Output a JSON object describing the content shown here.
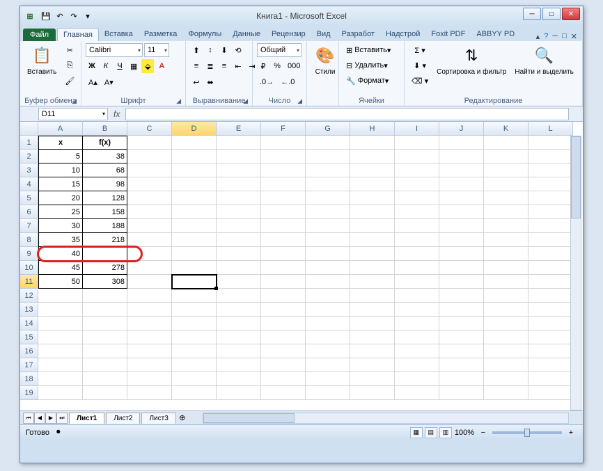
{
  "title": "Книга1 - Microsoft Excel",
  "tabs": {
    "file": "Файл",
    "items": [
      "Главная",
      "Вставка",
      "Разметка",
      "Формулы",
      "Данные",
      "Рецензир",
      "Вид",
      "Разработ",
      "Надстрой",
      "Foxit PDF",
      "ABBYY PD"
    ],
    "active": 0
  },
  "ribbon": {
    "clipboard": {
      "paste": "Вставить",
      "label": "Буфер обмена"
    },
    "font": {
      "name": "Calibri",
      "size": "11",
      "label": "Шрифт"
    },
    "align": {
      "label": "Выравнивание"
    },
    "number": {
      "format": "Общий",
      "label": "Число"
    },
    "styles": {
      "btn": "Стили",
      "label": ""
    },
    "cells": {
      "insert": "Вставить",
      "delete": "Удалить",
      "format": "Формат",
      "label": "Ячейки"
    },
    "editing": {
      "sort": "Сортировка и фильтр",
      "find": "Найти и выделить",
      "label": "Редактирование"
    }
  },
  "namebox": "D11",
  "columns": [
    "A",
    "B",
    "C",
    "D",
    "E",
    "F",
    "G",
    "H",
    "I",
    "J",
    "K",
    "L"
  ],
  "rows": 19,
  "selected": {
    "col": 3,
    "row": 11
  },
  "data": {
    "headers": [
      "x",
      "f(x)"
    ],
    "values": [
      [
        5,
        38
      ],
      [
        10,
        68
      ],
      [
        15,
        98
      ],
      [
        20,
        128
      ],
      [
        25,
        158
      ],
      [
        30,
        188
      ],
      [
        35,
        218
      ],
      [
        40,
        null
      ],
      [
        45,
        278
      ],
      [
        50,
        308
      ]
    ]
  },
  "highlight": {
    "row": 9
  },
  "sheets": {
    "items": [
      "Лист1",
      "Лист2",
      "Лист3"
    ],
    "active": 0
  },
  "status": {
    "ready": "Готово",
    "zoom": "100%"
  }
}
